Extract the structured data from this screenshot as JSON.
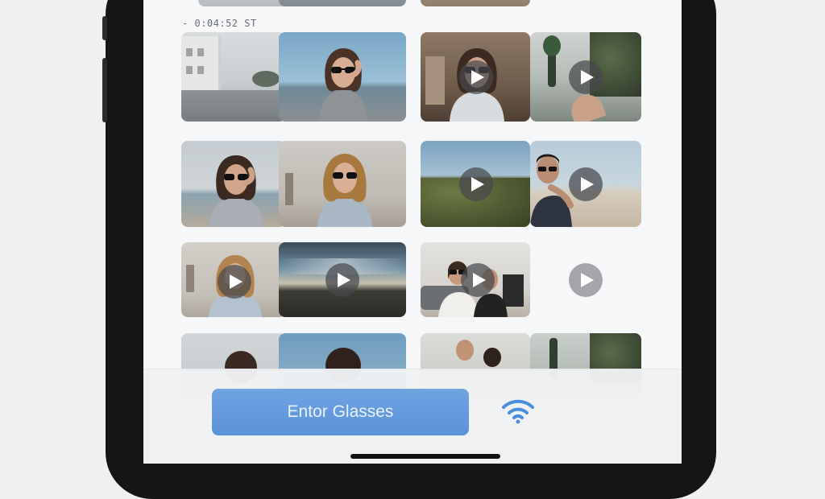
{
  "status": {
    "timestamp": "- 0:04:52 ST"
  },
  "gallery": {
    "items": [
      {
        "kind": "photo",
        "desc": "street"
      },
      {
        "kind": "photo",
        "desc": "woman-sunglasses-beach"
      },
      {
        "kind": "video",
        "desc": "woman-sunglasses-room"
      },
      {
        "kind": "video",
        "desc": "palm-tree-street"
      },
      {
        "kind": "photo",
        "desc": "woman-sunglasses-sea"
      },
      {
        "kind": "photo",
        "desc": "woman-sunglasses-studio"
      },
      {
        "kind": "video",
        "desc": "coastal-cliff"
      },
      {
        "kind": "video",
        "desc": "man-sunglasses-beach"
      },
      {
        "kind": "video",
        "desc": "woman-studio"
      },
      {
        "kind": "video",
        "desc": "sunset-sky"
      },
      {
        "kind": "video",
        "desc": "couple-living-room"
      },
      {
        "kind": "video",
        "desc": "empty"
      }
    ]
  },
  "action": {
    "primary_label": "Entor Glasses"
  },
  "icons": {
    "wifi": "wifi-icon",
    "play": "play-icon"
  },
  "colors": {
    "accent": "#5b93d8",
    "wifi": "#4a8ee0"
  }
}
